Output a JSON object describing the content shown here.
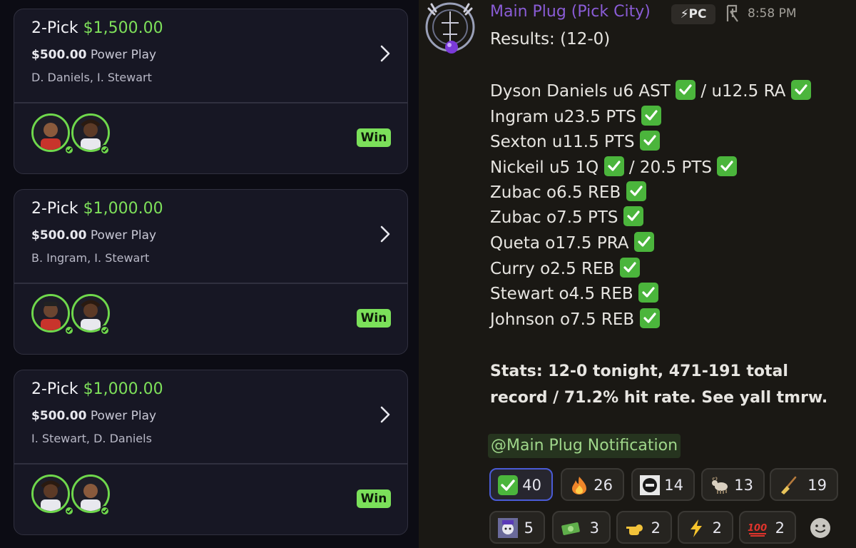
{
  "cards": [
    {
      "title_prefix": "2-Pick",
      "title_amount": "$1,500.00",
      "entry": "$500.00",
      "entry_type": "Power Play",
      "players": "D. Daniels, I. Stewart",
      "result": "Win"
    },
    {
      "title_prefix": "2-Pick",
      "title_amount": "$1,000.00",
      "entry": "$500.00",
      "entry_type": "Power Play",
      "players": "B. Ingram, I. Stewart",
      "result": "Win"
    },
    {
      "title_prefix": "2-Pick",
      "title_amount": "$1,000.00",
      "entry": "$500.00",
      "entry_type": "Power Play",
      "players": "I. Stewart, D. Daniels",
      "result": "Win"
    }
  ],
  "message": {
    "username": "Main Plug (Pick City)",
    "tag": "⚡PC",
    "timestamp": "8:58 PM",
    "results_header": "Results: (12-0)",
    "picks": [
      "Dyson Daniels u6 AST",
      "/ u12.5 RA",
      "Ingram u23.5 PTS",
      "Sexton u11.5 PTS",
      "Nickeil u5 1Q",
      "/ 20.5 PTS",
      "Zubac o6.5 REB",
      "Zubac o7.5 PTS",
      "Queta o17.5 PRA",
      "Curry o2.5 REB",
      "Stewart o4.5 REB",
      "Johnson o7.5 REB"
    ],
    "stats": "Stats: 12-0 tonight, 471-191 total record / 71.2% hit rate. See yall tmrw.",
    "mention": "@Main Plug Notification"
  },
  "reactions": [
    {
      "icon": "check-mark-emoji",
      "count": "40"
    },
    {
      "icon": "fire-emoji",
      "count": "26"
    },
    {
      "icon": "custom-face-emoji",
      "count": "14"
    },
    {
      "icon": "goat-emoji",
      "count": "13"
    },
    {
      "icon": "broom-emoji",
      "count": "19"
    },
    {
      "icon": "custom-character-emoji",
      "count": "5"
    },
    {
      "icon": "money-emoji",
      "count": "3"
    },
    {
      "icon": "pointing-hand-emoji",
      "count": "2"
    },
    {
      "icon": "lightning-emoji",
      "count": "2"
    },
    {
      "icon": "hundred-points-emoji",
      "count": "2"
    }
  ],
  "colors": {
    "win_green": "#7be05a",
    "username_purple": "#8a5cd6",
    "reaction_border": "#4a5bd6"
  }
}
